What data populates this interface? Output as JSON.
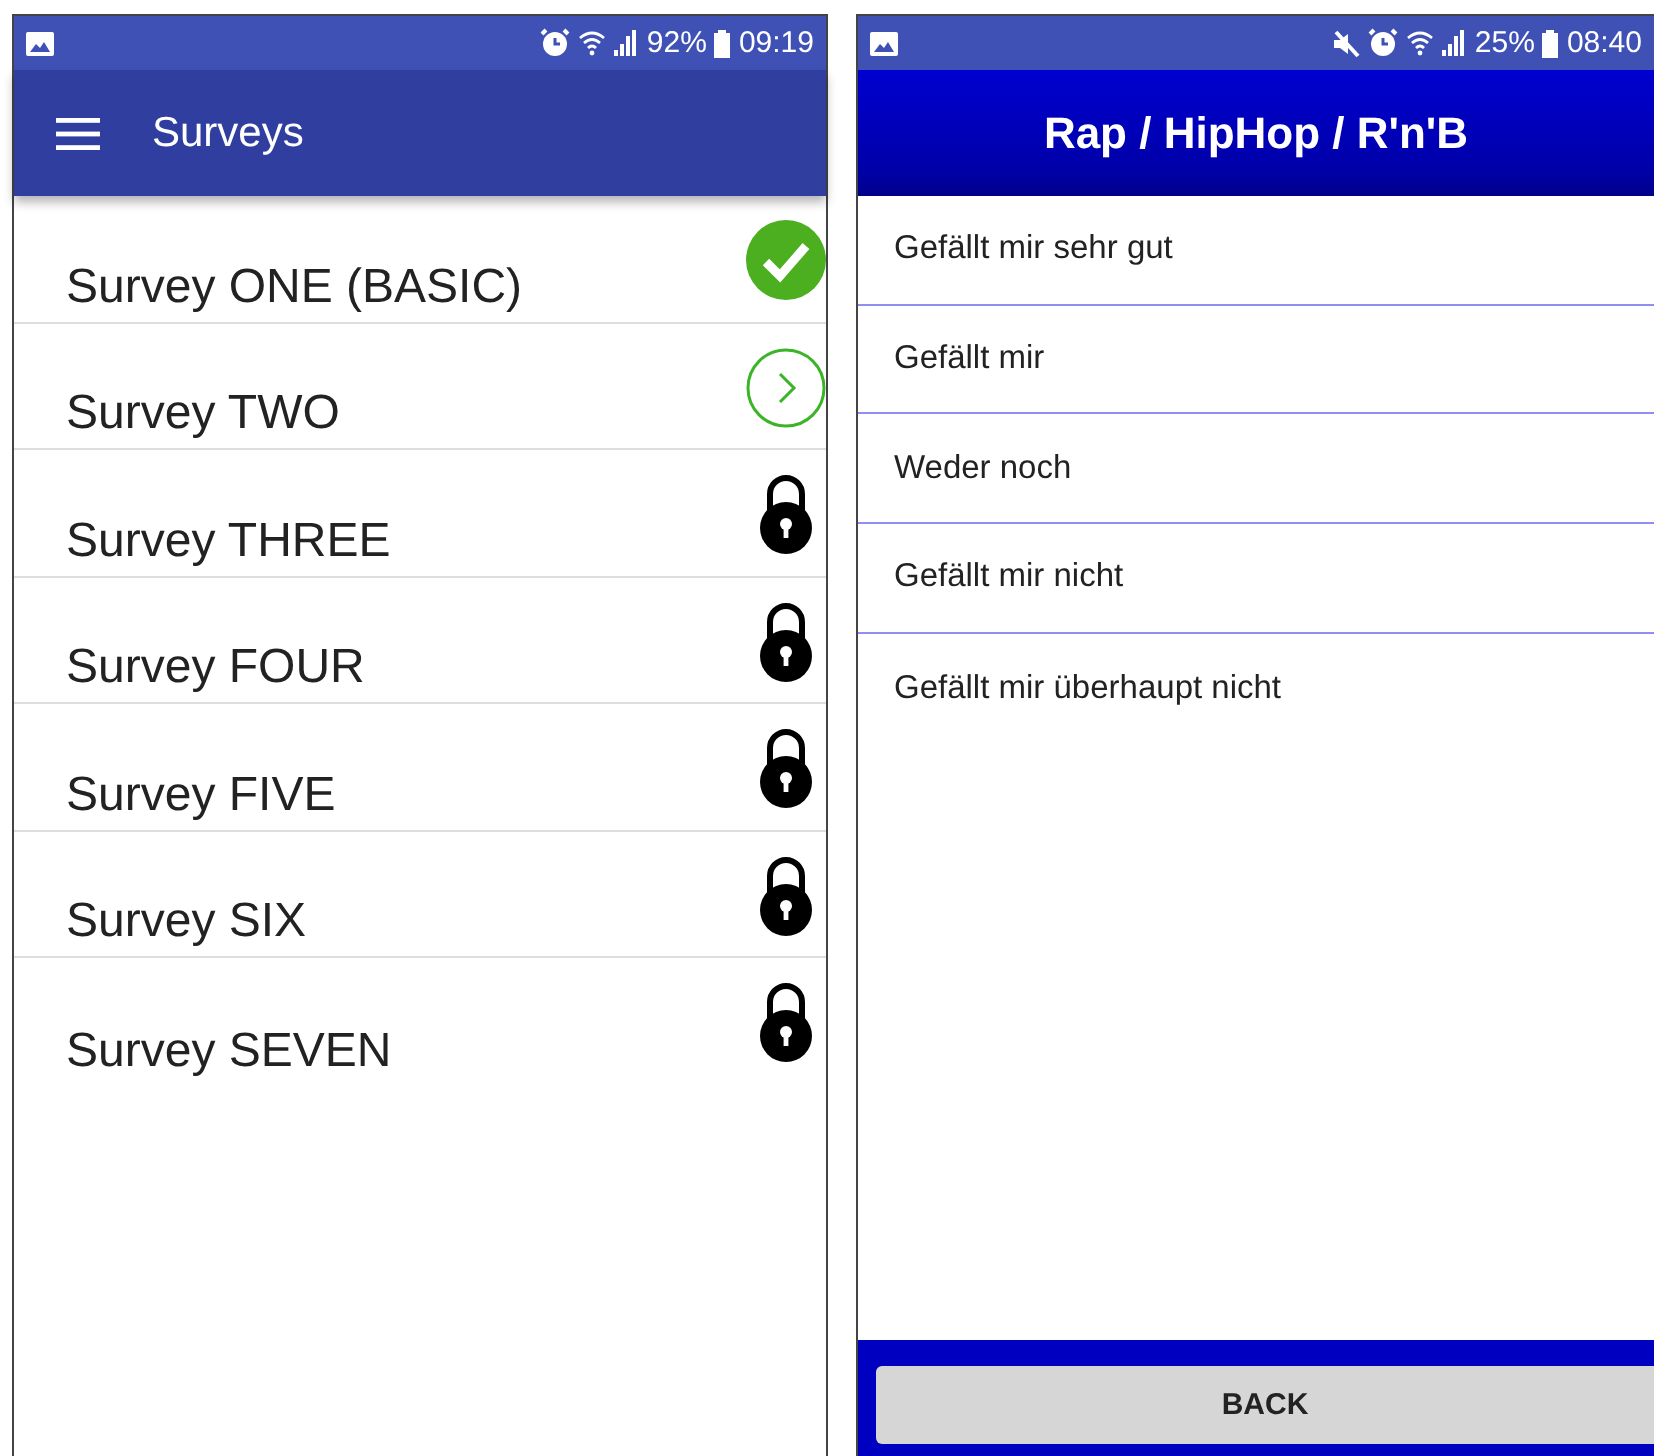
{
  "left_screen": {
    "status_bar": {
      "muted": false,
      "battery": "92%",
      "time": "09:19"
    },
    "toolbar": {
      "title": "Surveys"
    },
    "surveys": [
      {
        "name": "Survey ONE (BASIC)",
        "kind": "done"
      },
      {
        "name": "Survey TWO",
        "kind": "open"
      },
      {
        "name": "Survey THREE",
        "kind": "locked"
      },
      {
        "name": "Survey FOUR",
        "kind": "locked"
      },
      {
        "name": "Survey FIVE",
        "kind": "locked"
      },
      {
        "name": "Survey SIX",
        "kind": "locked"
      },
      {
        "name": "Survey SEVEN",
        "kind": "locked"
      }
    ]
  },
  "right_screen": {
    "status_bar": {
      "muted": true,
      "battery": "25%",
      "time": "08:40"
    },
    "header": {
      "title": "Rap / HipHop / R'n'B"
    },
    "answers": [
      "Gefällt mir sehr gut",
      "Gefällt mir",
      "Weder noch",
      "Gefällt mir nicht",
      "Gefällt mir überhaupt nicht"
    ],
    "back_button": "BACK"
  }
}
